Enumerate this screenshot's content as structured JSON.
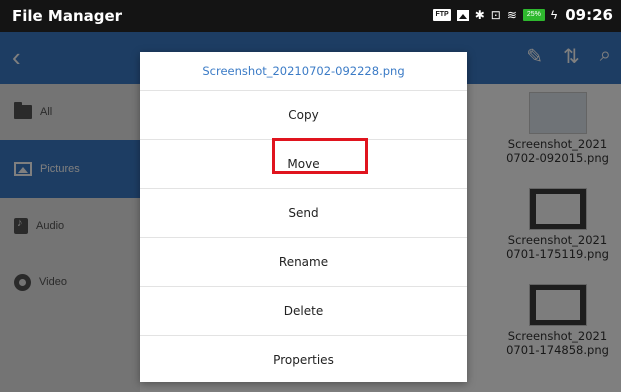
{
  "statusbar": {
    "app_title": "File Manager",
    "ftp_label": "FTP",
    "battery_label": "25%",
    "time": "09:26"
  },
  "toolbar": {
    "back_icon": "chevron-left-icon",
    "edit_icon": "pencil-icon",
    "sort_icon": "sort-icon",
    "search_icon": "search-icon"
  },
  "sidebar": {
    "items": [
      {
        "label": "All",
        "icon": "folder-icon"
      },
      {
        "label": "Pictures",
        "icon": "image-icon",
        "active": true
      },
      {
        "label": "Audio",
        "icon": "audio-icon"
      },
      {
        "label": "Video",
        "icon": "video-icon"
      }
    ]
  },
  "files": [
    {
      "name_line1": "Screenshot_2021",
      "name_line2": "0702-092015.png"
    },
    {
      "name_line1": "Screenshot_2021",
      "name_line2": "0701-175119.png"
    },
    {
      "name_line1": "Screenshot_2021",
      "name_line2": "0701-174858.png"
    }
  ],
  "dialog": {
    "title": "Screenshot_20210702-092228.png",
    "items": [
      "Copy",
      "Move",
      "Send",
      "Rename",
      "Delete",
      "Properties"
    ]
  },
  "colors": {
    "accent": "#3b7bc6",
    "highlight": "#e0141e",
    "statusbar": "#141414"
  }
}
